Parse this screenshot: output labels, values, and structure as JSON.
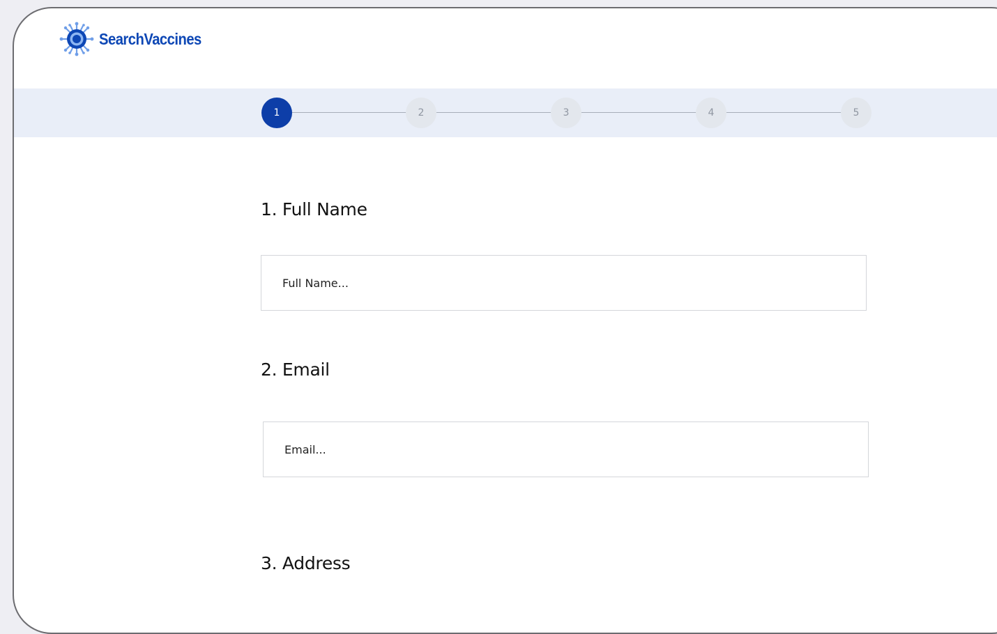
{
  "brand": {
    "name": "SearchVaccines",
    "color": "#0d47b5"
  },
  "stepper": {
    "active_step": 1,
    "active_color": "#0d3ea8",
    "steps": [
      "1",
      "2",
      "3",
      "4",
      "5"
    ]
  },
  "form": {
    "questions": [
      {
        "label": "1. Full Name",
        "placeholder": "Full Name..."
      },
      {
        "label": "2. Email",
        "placeholder": "Email..."
      },
      {
        "label": "3. Address"
      }
    ]
  }
}
